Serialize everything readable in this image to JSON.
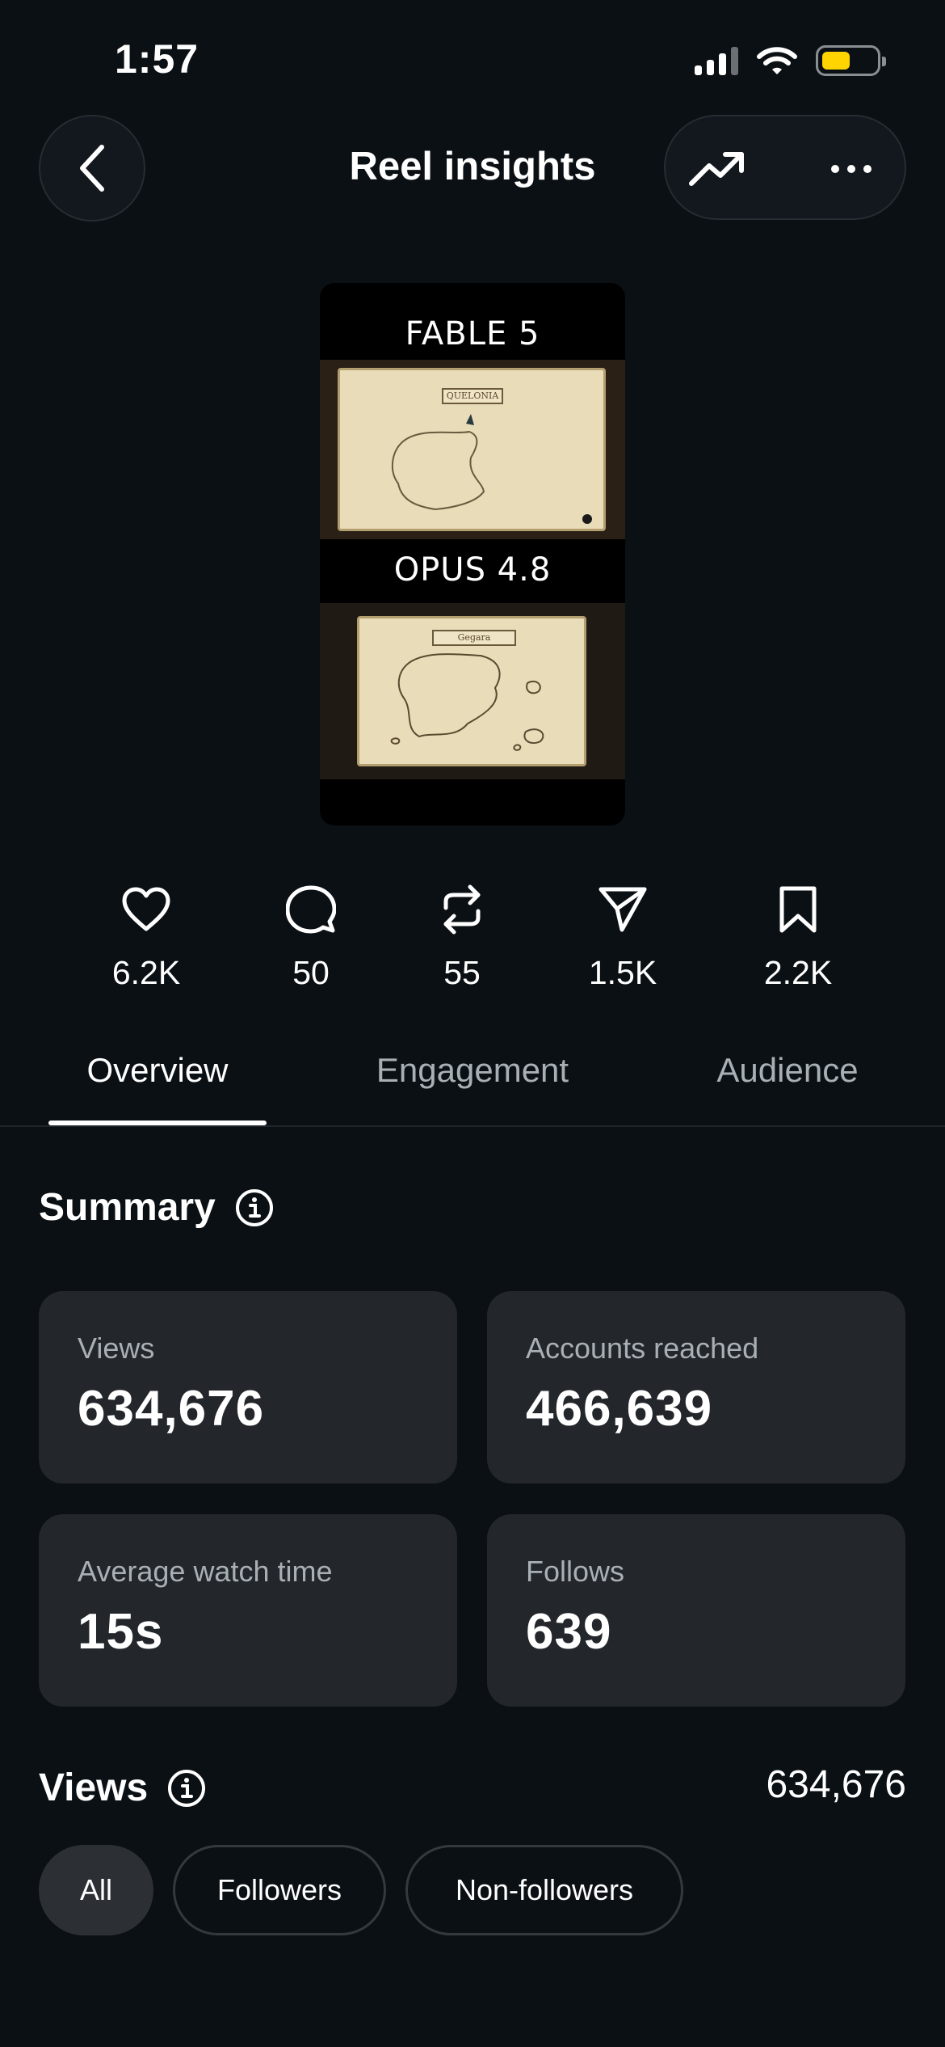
{
  "status_bar": {
    "time": "1:57"
  },
  "header": {
    "title": "Reel insights"
  },
  "thumbnail": {
    "top_label": "FABLE 5",
    "bottom_label": "OPUS 4.8",
    "map_title_top": "QUELONIA",
    "map_title_bottom": "Gegara"
  },
  "stats": [
    {
      "icon": "heart-icon",
      "value": "6.2K"
    },
    {
      "icon": "comment-icon",
      "value": "50"
    },
    {
      "icon": "repost-icon",
      "value": "55"
    },
    {
      "icon": "share-icon",
      "value": "1.5K"
    },
    {
      "icon": "bookmark-icon",
      "value": "2.2K"
    }
  ],
  "tabs": [
    {
      "label": "Overview",
      "active": true
    },
    {
      "label": "Engagement",
      "active": false
    },
    {
      "label": "Audience",
      "active": false
    }
  ],
  "summary": {
    "title": "Summary",
    "cards": [
      {
        "label": "Views",
        "value": "634,676"
      },
      {
        "label": "Accounts reached",
        "value": "466,639"
      },
      {
        "label": "Average watch time",
        "value": "15s"
      },
      {
        "label": "Follows",
        "value": "639"
      }
    ]
  },
  "views": {
    "title": "Views",
    "total": "634,676",
    "filters": [
      {
        "label": "All",
        "selected": true
      },
      {
        "label": "Followers",
        "selected": false
      },
      {
        "label": "Non-followers",
        "selected": false
      }
    ]
  },
  "colors": {
    "background": "#0b1014",
    "card": "#23262b",
    "battery": "#ffd400",
    "muted_text": "#a8b0b6"
  }
}
